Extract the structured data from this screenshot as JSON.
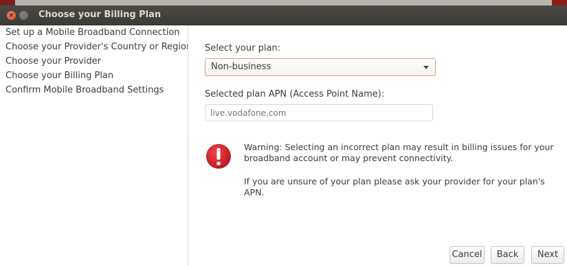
{
  "window": {
    "title": "Choose your Billing Plan"
  },
  "sidebar": {
    "items": [
      {
        "label": "Set up a Mobile Broadband Connection"
      },
      {
        "label": "Choose your Provider's Country or Region"
      },
      {
        "label": "Choose your Provider"
      },
      {
        "label": "Choose your Billing Plan"
      },
      {
        "label": "Confirm Mobile Broadband Settings"
      }
    ]
  },
  "plan": {
    "label": "Select your plan:",
    "selected": "Non-business"
  },
  "apn": {
    "label": "Selected plan APN (Access Point Name):",
    "placeholder": "live.vodafone.com"
  },
  "warning": {
    "icon": "warning-icon",
    "color": "#d8232a",
    "line1": "Warning: Selecting an incorrect plan may result in billing issues for your broadband account or may prevent connectivity.",
    "line2": "If you are unsure of your plan please ask your provider for your plan's APN."
  },
  "buttons": {
    "cancel": "Cancel",
    "back": "Back",
    "next": "Next"
  },
  "colors": {
    "titlebar": "#3c3b37",
    "close_button": "#df4a16",
    "combo_focus_border": "#e3967c"
  }
}
